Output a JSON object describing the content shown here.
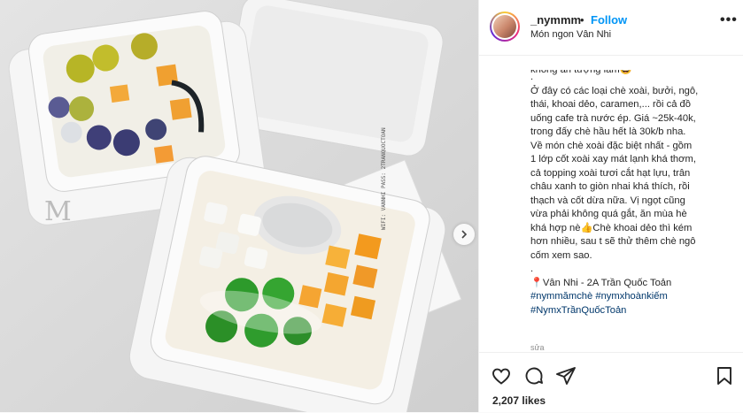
{
  "post": {
    "username": "_nymmm",
    "separator": "•",
    "follow_label": "Follow",
    "location": "Món ngon Vân Nhi",
    "more_label": "•••",
    "caption_cut_line": "không ấn tượng lắm😅",
    "caption_lines": [
      ".",
      "Ở đây có các loại chè xoài, bưởi, ngô,",
      "thái, khoai dẻo, caramen,... rồi cả đồ",
      "uống cafe trà nước ép. Giá ~25k-40k,",
      "trong đấy chè hầu hết là 30k/b nha.",
      "Về món chè xoài đặc biệt nhất - gồm",
      "1 lớp cốt xoài xay mát lạnh khá thơm,",
      "cả topping xoài tươi cắt hạt lựu, trân",
      "châu xanh to giòn nhai khá thích, rồi",
      "thạch và cốt dừa nữa. Vị ngọt cũng",
      "vừa phải không quá gắt, ăn mùa hè",
      "khá hợp nè👍Chè khoai dẻo thì kém",
      "hơn nhiều, sau t sẽ thử thêm chè ngô",
      "cốm xem sao.",
      "."
    ],
    "location_line": "📍Vân Nhi - 2A Trần Quốc Toản",
    "hashtags": [
      "#nymmămchè #nymxhoànkiếm",
      "#NymxTrầnQuốcToản"
    ],
    "faded_comment": "sửa",
    "likes": "2,207 likes",
    "watermark": "M",
    "ticket_text": "WIFI: VANNHI   PASS: 2TRANQUOCTOAN",
    "icons": [
      "heart-icon",
      "comment-icon",
      "share-icon",
      "bookmark-icon",
      "chevron-right-icon",
      "more-icon"
    ]
  }
}
